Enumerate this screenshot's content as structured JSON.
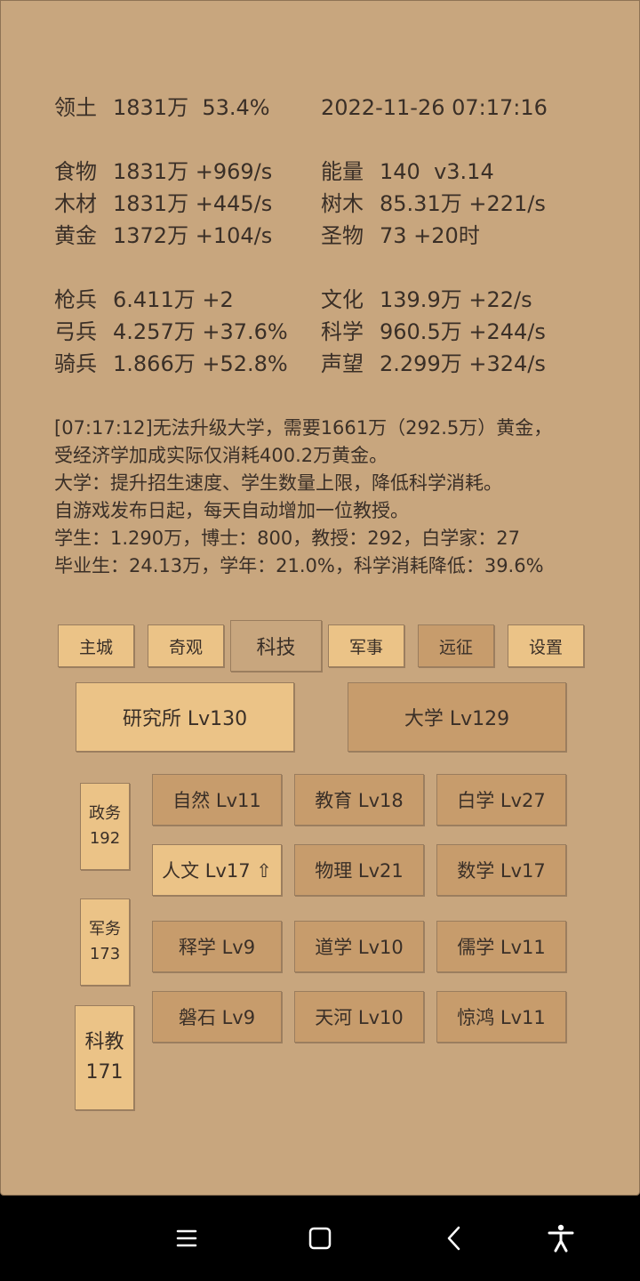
{
  "stats": {
    "territory": {
      "label": "领土",
      "value": "1831万  53.4%"
    },
    "datetime": "2022-11-26 07:17:16",
    "left": [
      {
        "label": "食物",
        "value": "1831万 +969/s"
      },
      {
        "label": "木材",
        "value": "1831万 +445/s"
      },
      {
        "label": "黄金",
        "value": "1372万 +104/s"
      },
      {
        "label": "枪兵",
        "value": "6.411万 +2"
      },
      {
        "label": "弓兵",
        "value": "4.257万 +37.6%"
      },
      {
        "label": "骑兵",
        "value": "1.866万 +52.8%"
      }
    ],
    "right": [
      {
        "label": "能量",
        "value": "140  v3.14"
      },
      {
        "label": "树木",
        "value": "85.31万 +221/s"
      },
      {
        "label": "圣物",
        "value": "73 +20时"
      },
      {
        "label": "文化",
        "value": "139.9万 +22/s"
      },
      {
        "label": "科学",
        "value": "960.5万 +244/s"
      },
      {
        "label": "声望",
        "value": "2.299万 +324/s"
      }
    ]
  },
  "log": [
    "[07:17:12]无法升级大学，需要1661万（292.5万）黄金，",
    "受经济学加成实际仅消耗400.2万黄金。",
    "大学：提升招生速度、学生数量上限，降低科学消耗。",
    "自游戏发布日起，每天自动增加一位教授。",
    "学生：1.290万，博士：800，教授：292，白学家：27",
    "毕业生：24.13万，学年：21.0%，科学消耗降低：39.6%"
  ],
  "tabs": [
    "主城",
    "奇观",
    "科技",
    "军事",
    "远征",
    "设置"
  ],
  "buildings": {
    "research": "研究所 Lv130",
    "university": "大学 Lv129"
  },
  "side": [
    {
      "line1": "政务",
      "line2": "192"
    },
    {
      "line1": "军务",
      "line2": "173"
    },
    {
      "line1": "科教",
      "line2": "171"
    }
  ],
  "techs": [
    "自然 Lv11",
    "教育 Lv18",
    "白学 Lv27",
    "人文 Lv17 ⇧",
    "物理 Lv21",
    "数学 Lv17",
    "释学 Lv9",
    "道学 Lv10",
    "儒学 Lv11",
    "磐石 Lv9",
    "天河 Lv10",
    "惊鸿 Lv11"
  ],
  "colors": {
    "background": "#c8a67e",
    "button_light": "#ebc387",
    "button_dark": "#c79c6c",
    "text": "#3a2f27"
  },
  "navbar_icons": [
    "menu-icon",
    "home-icon",
    "back-icon",
    "accessibility-icon"
  ]
}
